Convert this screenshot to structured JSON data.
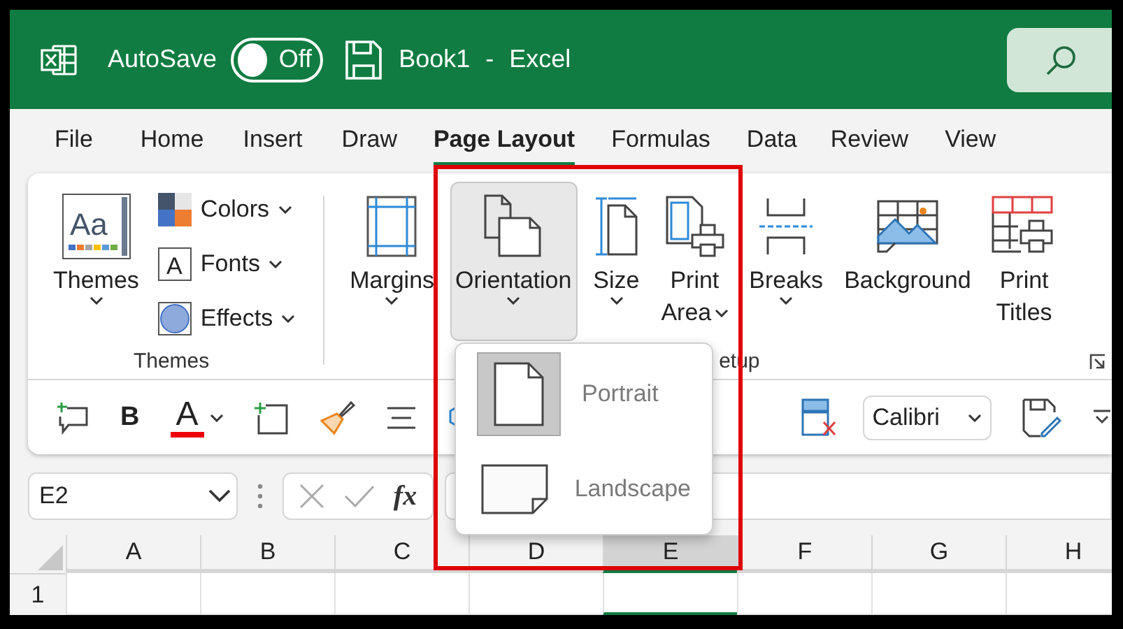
{
  "window": {
    "title_book": "Book1",
    "title_separator": "-",
    "title_app": "Excel",
    "autosave": {
      "label": "AutoSave",
      "on": false,
      "state_text": "Off"
    }
  },
  "tabs": [
    {
      "label": "File",
      "selected": false
    },
    {
      "label": "Home",
      "selected": false
    },
    {
      "label": "Insert",
      "selected": false
    },
    {
      "label": "Draw",
      "selected": false
    },
    {
      "label": "Page Layout",
      "selected": true
    },
    {
      "label": "Formulas",
      "selected": false
    },
    {
      "label": "Data",
      "selected": false
    },
    {
      "label": "Review",
      "selected": false
    },
    {
      "label": "View",
      "selected": false
    }
  ],
  "ribbon": {
    "themes_group": {
      "label": "Themes",
      "big_button": {
        "label": "Themes",
        "glyph": "Aa"
      },
      "small_buttons": [
        {
          "kind": "colors",
          "label": "Colors"
        },
        {
          "kind": "fonts",
          "label": "Fonts",
          "glyph": "A"
        },
        {
          "kind": "effects",
          "label": "Effects"
        }
      ]
    },
    "page_setup_group": {
      "label": "etup",
      "buttons": [
        {
          "kind": "margins",
          "lines": [
            "Margins"
          ],
          "dropdown": true,
          "caret_beside_label": false,
          "pressed": false
        },
        {
          "kind": "orientation",
          "lines": [
            "Orientation"
          ],
          "dropdown": true,
          "caret_beside_label": false,
          "pressed": true
        },
        {
          "kind": "size",
          "lines": [
            "Size"
          ],
          "dropdown": true,
          "caret_beside_label": false,
          "pressed": false
        },
        {
          "kind": "print-area",
          "lines": [
            "Print",
            "Area"
          ],
          "dropdown": true,
          "caret_beside_label": true,
          "pressed": false
        },
        {
          "kind": "breaks",
          "lines": [
            "Breaks"
          ],
          "dropdown": true,
          "caret_beside_label": false,
          "pressed": false
        },
        {
          "kind": "background",
          "lines": [
            "Background"
          ],
          "dropdown": false,
          "pressed": false
        },
        {
          "kind": "print-titles",
          "lines": [
            "Print",
            "Titles"
          ],
          "dropdown": false,
          "pressed": false
        }
      ]
    },
    "toolbar": {
      "bold_label": "B",
      "font_color_label": "A",
      "font": "Calibri"
    }
  },
  "formula_bar": {
    "name_box": "E2",
    "function_label": "fx"
  },
  "sheet": {
    "columns": [
      {
        "label": "A",
        "selected": false
      },
      {
        "label": "B",
        "selected": false
      },
      {
        "label": "C",
        "selected": false
      },
      {
        "label": "D",
        "selected": false
      },
      {
        "label": "E",
        "selected": true
      },
      {
        "label": "F",
        "selected": false
      },
      {
        "label": "G",
        "selected": false
      },
      {
        "label": "H",
        "selected": false
      }
    ],
    "rows": [
      {
        "label": "1"
      }
    ]
  },
  "orientation_menu": {
    "items": [
      {
        "kind": "portrait",
        "label": "Portrait",
        "selected": true
      },
      {
        "kind": "landscape",
        "label": "Landscape",
        "selected": false
      }
    ]
  }
}
